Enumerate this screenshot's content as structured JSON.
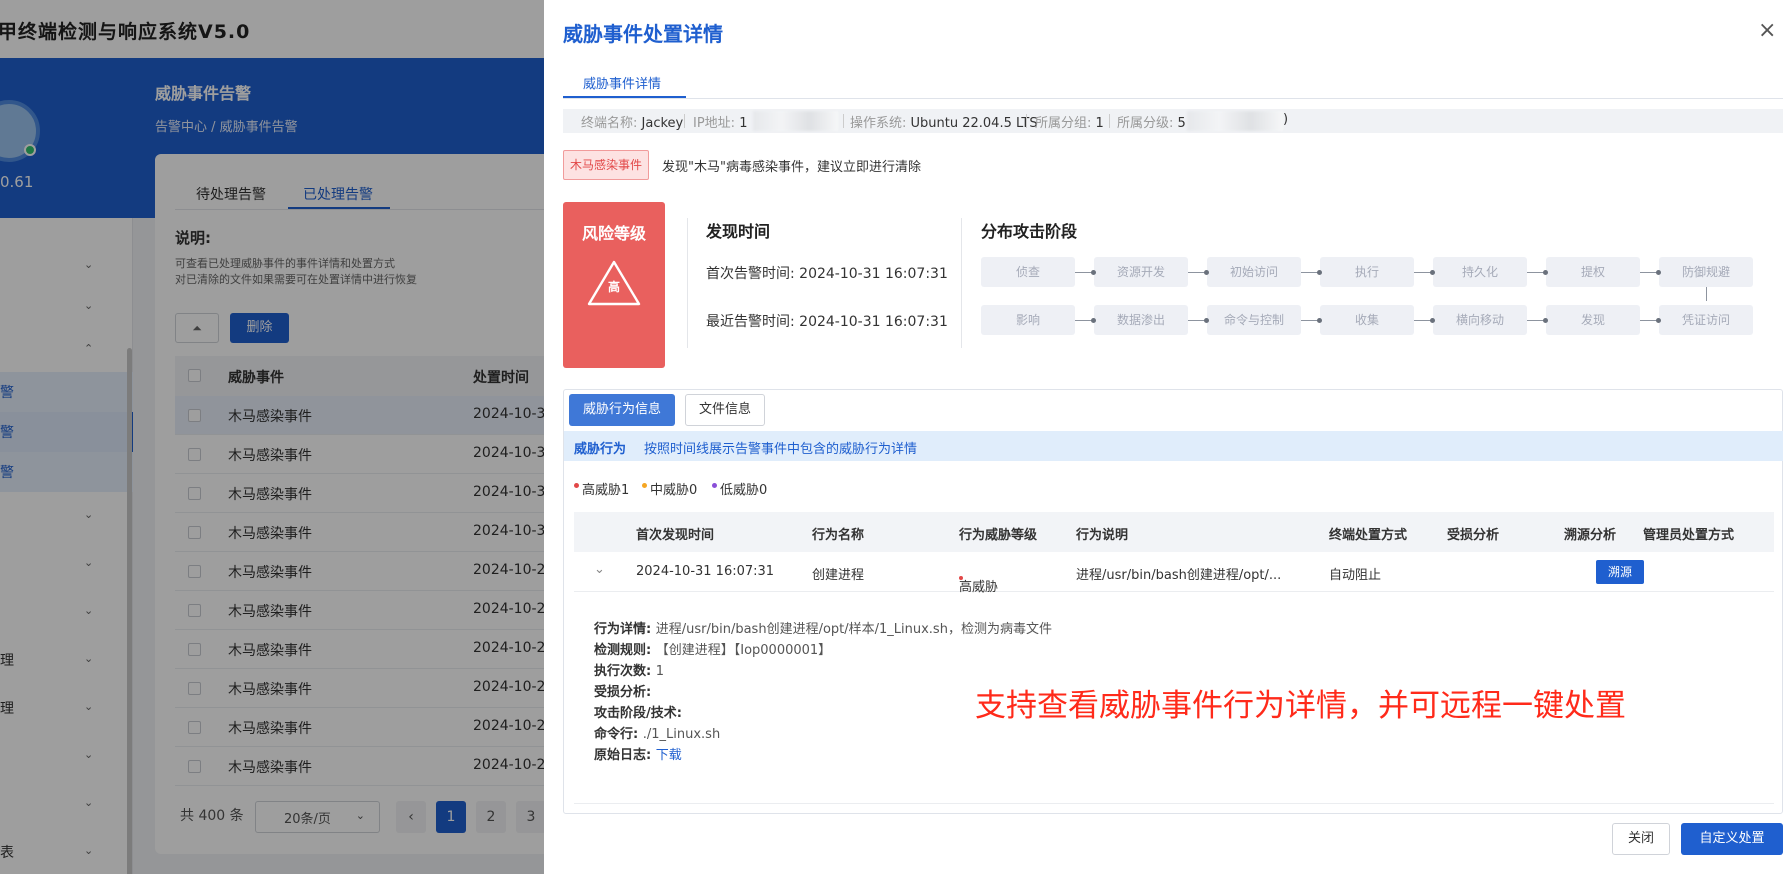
{
  "app": {
    "title": "甲终端检测与响应系统V5.0",
    "version": "0.61"
  },
  "sidebar": {
    "items": [
      {
        "label": "",
        "chevron": "⌄"
      },
      {
        "label": "",
        "chevron": "⌄"
      },
      {
        "label": "",
        "chevron": "⌃"
      },
      {
        "label": "警",
        "chevron": ""
      },
      {
        "label": "警",
        "chevron": ""
      },
      {
        "label": "警",
        "chevron": ""
      },
      {
        "label": "",
        "chevron": "⌄"
      },
      {
        "label": "",
        "chevron": "⌄"
      },
      {
        "label": "",
        "chevron": "⌄"
      },
      {
        "label": "理",
        "chevron": "⌄"
      },
      {
        "label": "理",
        "chevron": "⌄"
      },
      {
        "label": "",
        "chevron": "⌄"
      },
      {
        "label": "",
        "chevron": "⌄"
      },
      {
        "label": "表",
        "chevron": "⌄"
      }
    ]
  },
  "page": {
    "title": "威胁事件告警",
    "breadcrumb": "告警中心  /  威胁事件告警",
    "tabs": [
      "待处理告警",
      "已处理告警"
    ],
    "desc_title": "说明:",
    "desc_lines": [
      "可查看已处理威胁事件的事件详情和处置方式",
      "对已清除的文件如果需要可在处置详情中进行恢复"
    ],
    "icon_button": "⏶",
    "delete_button": "删除",
    "columns": [
      "威胁事件",
      "处置时间"
    ],
    "rows": [
      {
        "event": "木马感染事件",
        "time": "2024-10-3"
      },
      {
        "event": "木马感染事件",
        "time": "2024-10-3"
      },
      {
        "event": "木马感染事件",
        "time": "2024-10-3"
      },
      {
        "event": "木马感染事件",
        "time": "2024-10-3"
      },
      {
        "event": "木马感染事件",
        "time": "2024-10-2"
      },
      {
        "event": "木马感染事件",
        "time": "2024-10-2"
      },
      {
        "event": "木马感染事件",
        "time": "2024-10-2"
      },
      {
        "event": "木马感染事件",
        "time": "2024-10-2"
      },
      {
        "event": "木马感染事件",
        "time": "2024-10-2"
      },
      {
        "event": "木马感染事件",
        "time": "2024-10-2"
      }
    ],
    "total": "共 400 条",
    "page_size": "20条/页",
    "pages": [
      "‹",
      "1",
      "2",
      "3"
    ]
  },
  "drawer": {
    "title": "威胁事件处置详情",
    "close": "×",
    "tab": "威胁事件详情",
    "info": [
      {
        "key": "终端名称: ",
        "value": "Jackey"
      },
      {
        "key": "IP地址: ",
        "value": "1"
      },
      {
        "key": "操作系统: ",
        "value": "Ubuntu 22.04.5 LTS"
      },
      {
        "key": "所属分组: ",
        "value": "1"
      },
      {
        "key": "所属分级: ",
        "value": "5"
      }
    ],
    "info_tail": ")",
    "event_tag": "木马感染事件",
    "event_msg": "发现\"木马\"病毒感染事件，建议立即进行清除",
    "risk": {
      "title": "风险等级",
      "level": "高"
    },
    "found": {
      "title": "发现时间",
      "first": "首次告警时间: 2024-10-31 16:07:31",
      "last": "最近告警时间: 2024-10-31 16:07:31"
    },
    "stages": {
      "title": "分布攻击阶段",
      "row1": [
        "侦查",
        "资源开发",
        "初始访问",
        "执行",
        "持久化",
        "提权",
        "防御规避"
      ],
      "row2": [
        "影响",
        "数据渗出",
        "命令与控制",
        "收集",
        "横向移动",
        "发现",
        "凭证访问"
      ]
    },
    "panel_tabs": [
      "威胁行为信息",
      "文件信息"
    ],
    "hint_bold": "威胁行为",
    "hint_text": "按照时间线展示告警事件中包含的威胁行为详情",
    "legend": [
      {
        "label": "高威胁1",
        "color": "#e24848"
      },
      {
        "label": "中威胁0",
        "color": "#f5a623"
      },
      {
        "label": "低威胁0",
        "color": "#8a4fd8"
      }
    ],
    "table": {
      "columns": [
        "首次发现时间",
        "行为名称",
        "行为威胁等级",
        "行为说明",
        "终端处置方式",
        "受损分析",
        "溯源分析",
        "管理员处置方式"
      ],
      "row": {
        "expand": "⌄",
        "time": "2024-10-31 16:07:31",
        "name": "创建进程",
        "level": "高威胁",
        "desc": "进程/usr/bin/bash创建进程/opt/...",
        "action": "自动阻止",
        "trace": "溯源"
      }
    },
    "detail": [
      {
        "label": "行为详情: ",
        "value": "进程/usr/bin/bash创建进程/opt/样本/1_Linux.sh，检测为病毒文件"
      },
      {
        "label": "检测规则: ",
        "value": "【创建进程】【Iop0000001】"
      },
      {
        "label": "执行次数: ",
        "value": "1"
      },
      {
        "label": "受损分析: ",
        "value": ""
      },
      {
        "label": "攻击阶段/技术: ",
        "value": ""
      },
      {
        "label": "命令行: ",
        "value": "./1_Linux.sh"
      },
      {
        "label": "原始日志: ",
        "value": "下载"
      }
    ],
    "annotation": "支持查看威胁事件行为详情，并可远程一键处置",
    "footer": {
      "close": "关闭",
      "custom": "自定义处置"
    }
  },
  "colors": {
    "primary": "#1f5fcf",
    "risk": "#e9605e",
    "annotation": "#ff2a1a"
  },
  "icons": [
    "close-icon",
    "warning-triangle-icon",
    "chevron-down-icon",
    "avatar-icon"
  ]
}
